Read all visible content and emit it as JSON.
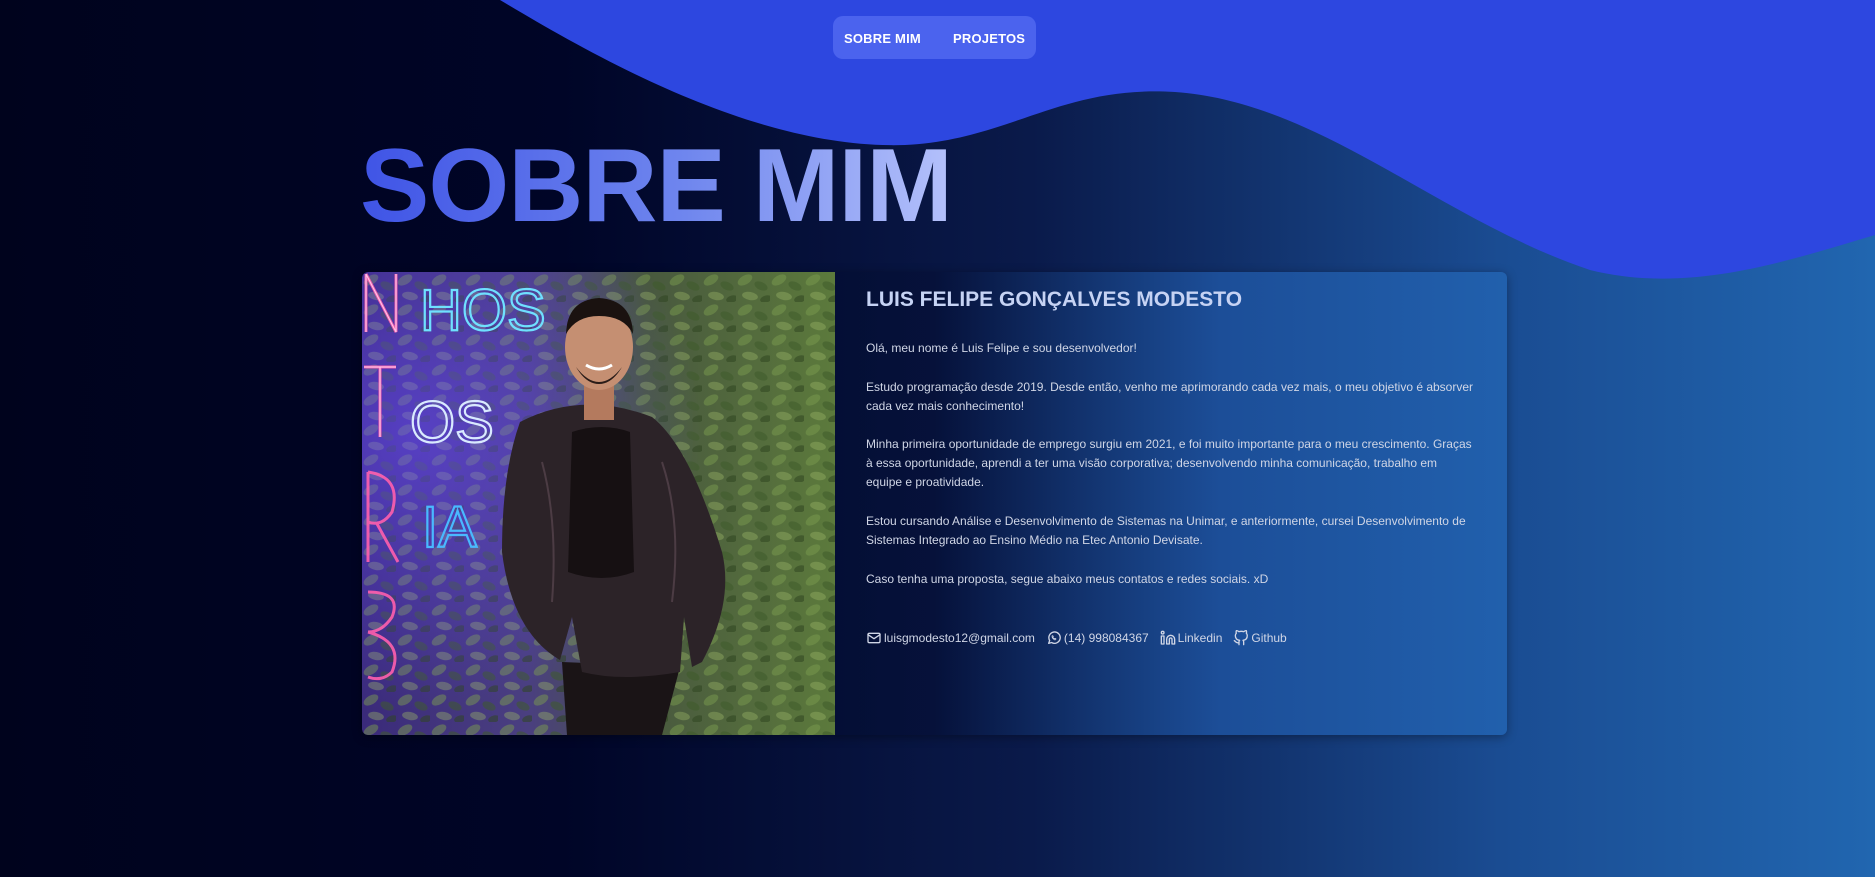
{
  "nav": {
    "items": [
      {
        "label": "SOBRE MIM"
      },
      {
        "label": "PROJETOS"
      }
    ]
  },
  "page": {
    "title": "SOBRE MIM"
  },
  "profile": {
    "name": "LUIS FELIPE GONÇALVES MODESTO",
    "paragraphs": [
      "Olá, meu nome é Luis Felipe e sou desenvolvedor!",
      "Estudo programação desde 2019. Desde então, venho me aprimorando cada vez mais, o meu objetivo é absorver cada vez mais conhecimento!",
      "Minha primeira oportunidade de emprego surgiu em 2021, e foi muito importante para o meu crescimento. Graças à essa oportunidade, aprendi a ter uma visão corporativa; desenvolvendo minha comunicação, trabalho em equipe e proatividade.",
      "Estou cursando Análise e Desenvolvimento de Sistemas na Unimar, e anteriormente, cursei Desenvolvimento de Sistemas Integrado ao Ensino Médio na Etec Antonio Devisate.",
      "Caso tenha uma proposta, segue abaixo meus contatos e redes sociais. xD"
    ],
    "photo": {
      "neon_words": [
        "HOS",
        "OS",
        "IA"
      ]
    }
  },
  "contacts": [
    {
      "icon": "mail-icon",
      "label": "luisgmodesto12@gmail.com"
    },
    {
      "icon": "whatsapp-icon",
      "label": "(14) 998084367"
    },
    {
      "icon": "linkedin-icon",
      "label": "Linkedin"
    },
    {
      "icon": "github-icon",
      "label": "Github"
    }
  ],
  "colors": {
    "wave": "#2d47e0",
    "nav_bg": "#4b63ee",
    "background_dark": "#00031d",
    "background_light": "#2166b0",
    "name_text": "#c6d3f4"
  }
}
